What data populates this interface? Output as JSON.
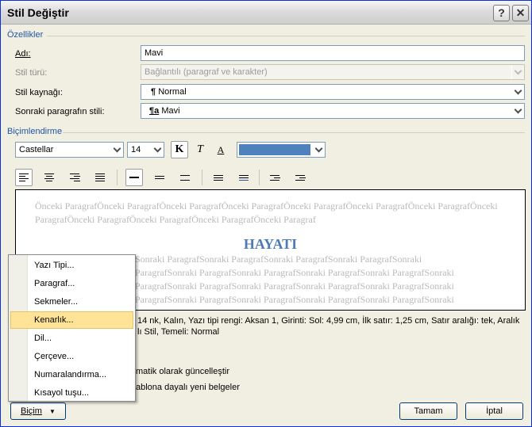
{
  "window": {
    "title": "Stil Değiştir",
    "help_label": "?",
    "close_label": "✕"
  },
  "properties": {
    "section_label": "Özellikler",
    "name": {
      "label": "Adı:",
      "value": "Mavi"
    },
    "style_type": {
      "label": "Stil türü:",
      "value": "Bağlantılı (paragraf ve karakter)"
    },
    "based_on": {
      "label": "Stil kaynağı:",
      "value": "Normal",
      "glyph": "¶"
    },
    "next_style": {
      "label": "Sonraki paragrafın stili:",
      "value": "Mavi",
      "glyph": "¶a"
    }
  },
  "formatting": {
    "section_label": "Biçimlendirme",
    "font": "Castellar",
    "size": "14",
    "bold_label": "K",
    "italic_label": "T",
    "underline_label": "A",
    "color_hex": "#4f81bd"
  },
  "preview": {
    "prev_text": "Önceki ParagrafÖnceki ParagrafÖnceki ParagrafÖnceki ParagrafÖnceki ParagrafÖnceki ParagrafÖnceki ParagrafÖnceki ParagrafÖnceki ParagrafÖnceki ParagrafÖnceki ParagrafÖnceki Paragraf",
    "heading": "HAYATI",
    "next_line_1": "Sonraki ParagrafSonraki ParagrafSonraki ParagrafSonraki ParagrafSonraki",
    "next_line_2": "ParagrafSonraki ParagrafSonraki ParagrafSonraki ParagrafSonraki ParagrafSonraki",
    "next_line_3": "ParagrafSonraki ParagrafSonraki ParagrafSonraki ParagrafSonraki ParagrafSonraki",
    "next_line_4": "ParagrafSonraki ParagrafSonraki ParagrafSonraki ParagrafSonraki ParagrafSonraki"
  },
  "description": {
    "line_1": "14 nk, Kalın, Yazı tipi rengi: Aksan 1, Girinti: Sol:  4,99 cm, İlk satır:  1,25 cm, Satır aralığı:  tek, Aralık",
    "line_2": "lı Stil, Temeli: Normal"
  },
  "options": {
    "auto_update": "matik olarak güncelleştir",
    "new_docs": "ablona dayalı yeni belgeler"
  },
  "buttons": {
    "format_label": "Biçim",
    "ok_label": "Tamam",
    "cancel_label": "İptal"
  },
  "format_menu": {
    "items": [
      "Yazı Tipi...",
      "Paragraf...",
      "Sekmeler...",
      "Kenarlık...",
      "Dil...",
      "Çerçeve...",
      "Numaralandırma...",
      "Kısayol tuşu..."
    ],
    "highlighted": "Kenarlık..."
  }
}
